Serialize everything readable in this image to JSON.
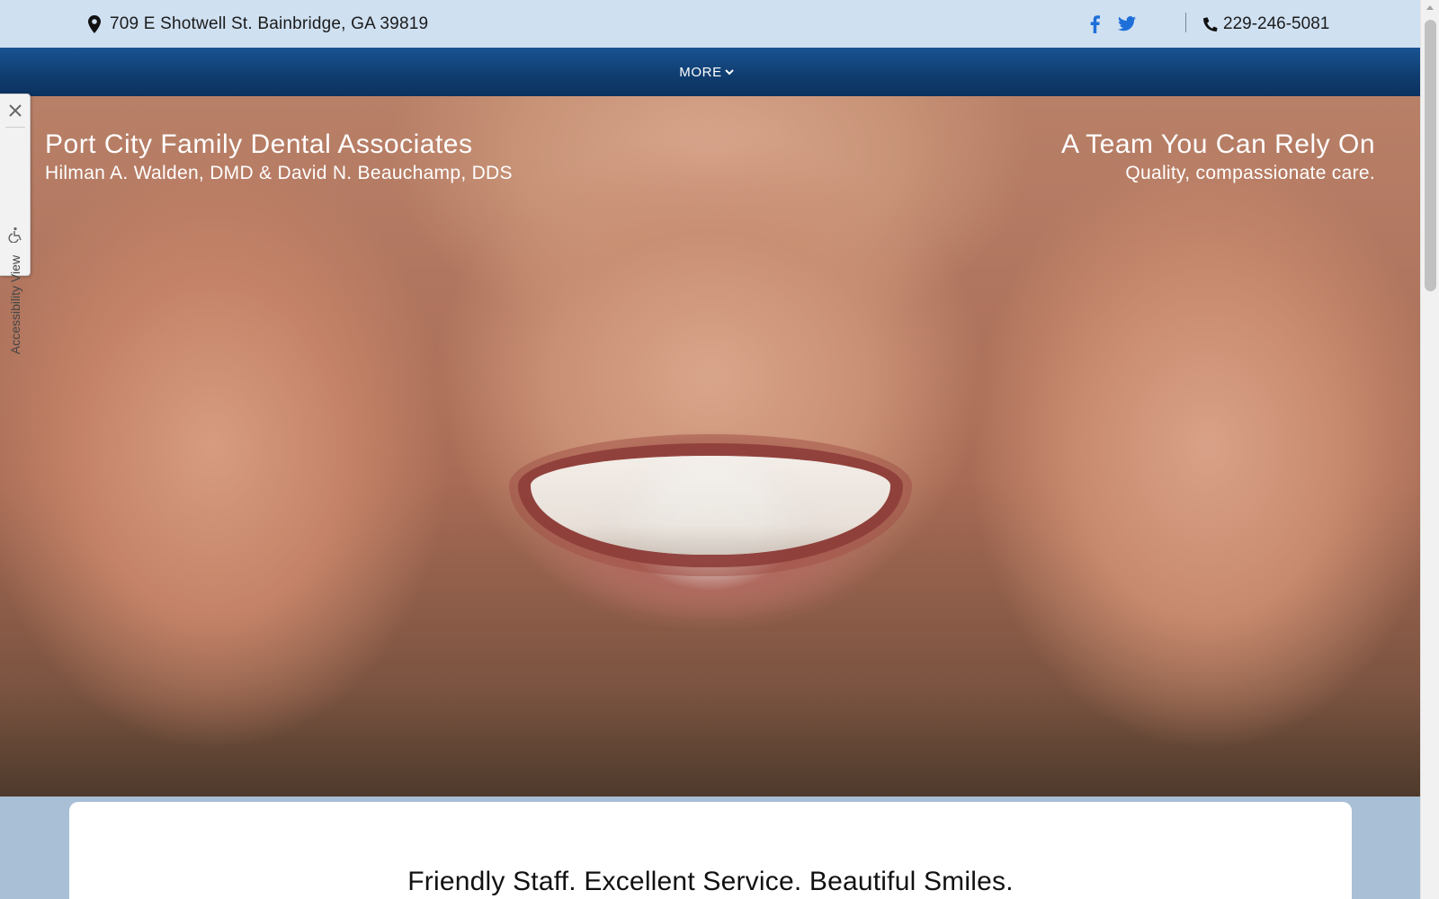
{
  "topbar": {
    "address": "709 E Shotwell St. Bainbridge, GA 39819",
    "phone": "229-246-5081",
    "social_icons": [
      "facebook-icon",
      "twitter-icon"
    ]
  },
  "nav": {
    "more_label": "MORE"
  },
  "hero": {
    "left_title": "Port City Family Dental Associates",
    "left_subtitle": "Hilman A. Walden, DMD & David N. Beauchamp, DDS",
    "right_title": "A Team You Can Rely On",
    "right_subtitle": "Quality, compassionate care."
  },
  "accessibility": {
    "label": "Accessibility View"
  },
  "content": {
    "heading": "Friendly Staff. Excellent Service. Beautiful Smiles."
  },
  "colors": {
    "topbar_bg": "#cfe0f1",
    "nav_bg": "#0f3c6e",
    "social_blue": "#1e6fd9",
    "page_bg": "#a9bfd6"
  }
}
